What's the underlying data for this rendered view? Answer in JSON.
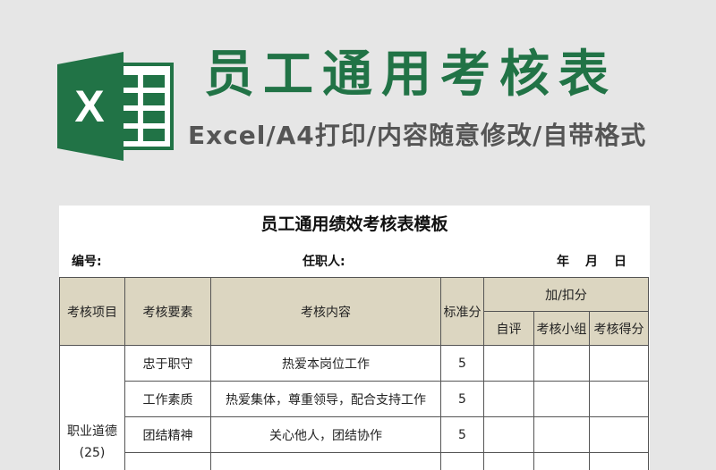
{
  "banner": {
    "logo_letter": "X",
    "title": "员工通用考核表",
    "subtitle": "Excel/A4打印/内容随意修改/自带格式",
    "brand_color": "#217346"
  },
  "sheet": {
    "title": "员工通用绩效考核表模板",
    "number_label": "编号:",
    "person_label": "任职人:",
    "date_labels": [
      "年",
      "月",
      "日"
    ],
    "headers": {
      "item": "考核项目",
      "element": "考核要素",
      "content": "考核内容",
      "standard": "标准分",
      "adjust": "加/扣分",
      "self": "自评",
      "group": "考核小组",
      "score": "考核得分"
    },
    "category": {
      "name": "职业道德",
      "score": "(25)"
    },
    "rows": [
      {
        "element": "忠于职守",
        "content": "热爱本岗位工作",
        "standard": "5"
      },
      {
        "element": "工作素质",
        "content": "热爱集体，尊重领导，配合支持工作",
        "standard": "5"
      },
      {
        "element": "团结精神",
        "content": "关心他人，团结协作",
        "standard": "5"
      }
    ]
  }
}
